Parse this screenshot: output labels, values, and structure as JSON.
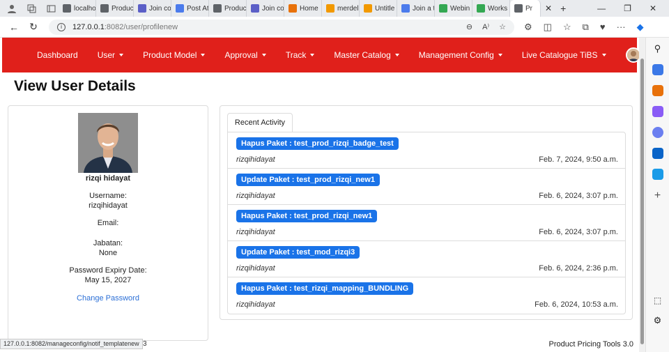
{
  "browser": {
    "tabs": [
      {
        "label": "localho",
        "color": "#5f6368"
      },
      {
        "label": "Produc",
        "color": "#5f6368"
      },
      {
        "label": "Join co",
        "color": "#5b5fc7"
      },
      {
        "label": "Post At",
        "color": "#4b7bec"
      },
      {
        "label": "Produc",
        "color": "#5f6368"
      },
      {
        "label": "Join co",
        "color": "#5b5fc7"
      },
      {
        "label": "Home",
        "color": "#e8710a"
      },
      {
        "label": "merdel",
        "color": "#f29900"
      },
      {
        "label": "Untitle",
        "color": "#f29900"
      },
      {
        "label": "Join a t",
        "color": "#4b7bec"
      },
      {
        "label": "Webin",
        "color": "#34a853"
      },
      {
        "label": "Works",
        "color": "#34a853"
      },
      {
        "label": "Pr",
        "color": "#5f6368"
      }
    ],
    "url_host": "127.0.0.1",
    "url_path": ":8082/user/profilenew"
  },
  "nav": {
    "items": [
      {
        "label": "Dashboard",
        "caret": false
      },
      {
        "label": "User",
        "caret": true
      },
      {
        "label": "Product Model",
        "caret": true
      },
      {
        "label": "Approval",
        "caret": true
      },
      {
        "label": "Track",
        "caret": true
      },
      {
        "label": "Master Catalog",
        "caret": true
      },
      {
        "label": "Management Config",
        "caret": true
      },
      {
        "label": "Live Catalogue TiBS",
        "caret": true
      }
    ],
    "brand_color": "#e0201b"
  },
  "page": {
    "title": "View User Details"
  },
  "profile": {
    "name": "rizqi hidayat",
    "username_label": "Username:",
    "username": "rizqihidayat",
    "email_label": "Email:",
    "email": "",
    "jabatan_label": "Jabatan:",
    "jabatan": "None",
    "expiry_label": "Password Expiry Date:",
    "expiry": "May 15, 2027",
    "change_password": "Change Password"
  },
  "activity": {
    "tab_label": "Recent Activity",
    "rows": [
      {
        "action": "Hapus Paket : test_prod_rizqi_badge_test",
        "user": "rizqihidayat",
        "time": "Feb. 7, 2024, 9:50 a.m."
      },
      {
        "action": "Update Paket : test_prod_rizqi_new1",
        "user": "rizqihidayat",
        "time": "Feb. 6, 2024, 3:07 p.m."
      },
      {
        "action": "Hapus Paket : test_prod_rizqi_new1",
        "user": "rizqihidayat",
        "time": "Feb. 6, 2024, 3:07 p.m."
      },
      {
        "action": "Update Paket : test_mod_rizqi3",
        "user": "rizqihidayat",
        "time": "Feb. 6, 2024, 2:36 p.m."
      },
      {
        "action": "Hapus Paket : test_rizqi_mapping_BUNDLING",
        "user": "rizqihidayat",
        "time": "Feb. 6, 2024, 10:53 a.m."
      }
    ]
  },
  "status_url": "127.0.0.1:8082/manageconfig/notif_templatenew",
  "status_tail": "3",
  "footer": "Product Pricing Tools 3.0"
}
